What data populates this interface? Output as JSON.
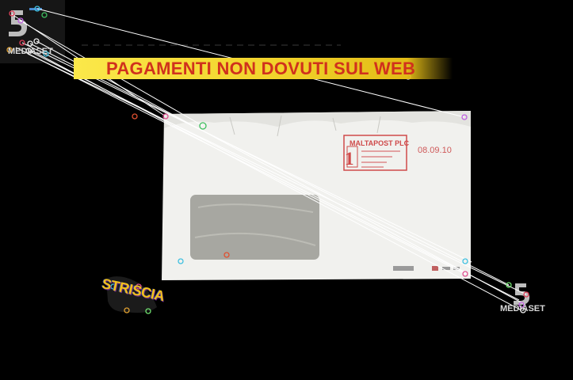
{
  "banner": {
    "text": "PAGAMENTI NON DOVUTI SUL WEB",
    "color": "#d0311d",
    "background": "#f1d22a"
  },
  "logo": {
    "name": "mediaset-canale5-logo",
    "text": "MEDIASET"
  },
  "envelope": {
    "postmark_company": "MALTAPOST PLC",
    "postage_number": "1",
    "date": "08.09.10",
    "window": "address-window"
  },
  "show_logo": {
    "text": "STRISCIA",
    "color": "#f2c21a"
  },
  "overlay": {
    "type": "feature-match-lines",
    "line_color": "#ffffff",
    "keypoint_colors": [
      "#e0405a",
      "#40c0e0",
      "#3fbf5f",
      "#c060e0",
      "#e0a030",
      "#f0f0f0",
      "#70e070",
      "#e05090"
    ]
  }
}
